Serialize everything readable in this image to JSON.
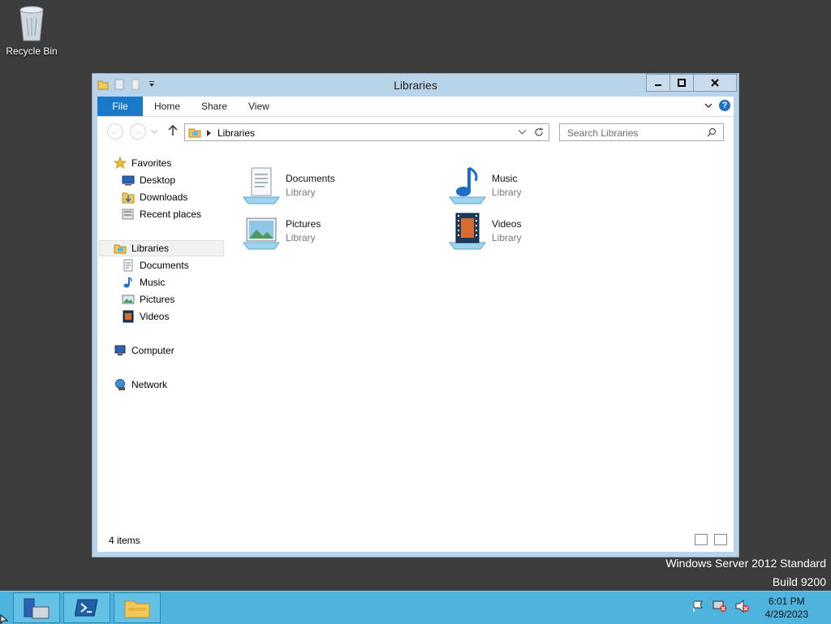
{
  "desktop": {
    "recycle_bin_label": "Recycle Bin",
    "watermark_line1": "Windows Server 2012 Standard",
    "watermark_line2": "Build 9200"
  },
  "window": {
    "title": "Libraries",
    "ribbon_tabs": {
      "file": "File",
      "home": "Home",
      "share": "Share",
      "view": "View"
    },
    "help_glyph": "?",
    "address": "Libraries",
    "search_placeholder": "Search Libraries",
    "nav": {
      "favorites": "Favorites",
      "desktop": "Desktop",
      "downloads": "Downloads",
      "recent_places": "Recent places",
      "libraries": "Libraries",
      "documents": "Documents",
      "music": "Music",
      "pictures": "Pictures",
      "videos": "Videos",
      "computer": "Computer",
      "network": "Network"
    },
    "libraries": [
      {
        "name": "Documents",
        "sub": "Library"
      },
      {
        "name": "Music",
        "sub": "Library"
      },
      {
        "name": "Pictures",
        "sub": "Library"
      },
      {
        "name": "Videos",
        "sub": "Library"
      }
    ],
    "status_count": "4 items"
  },
  "taskbar": {
    "time": "6:01 PM",
    "date": "4/29/2023"
  },
  "colors": {
    "desktop_bg": "#3c3c3c",
    "window_frame": "#b9d4e8",
    "file_tab": "#1979ca",
    "taskbar": "#4fb4dd"
  }
}
